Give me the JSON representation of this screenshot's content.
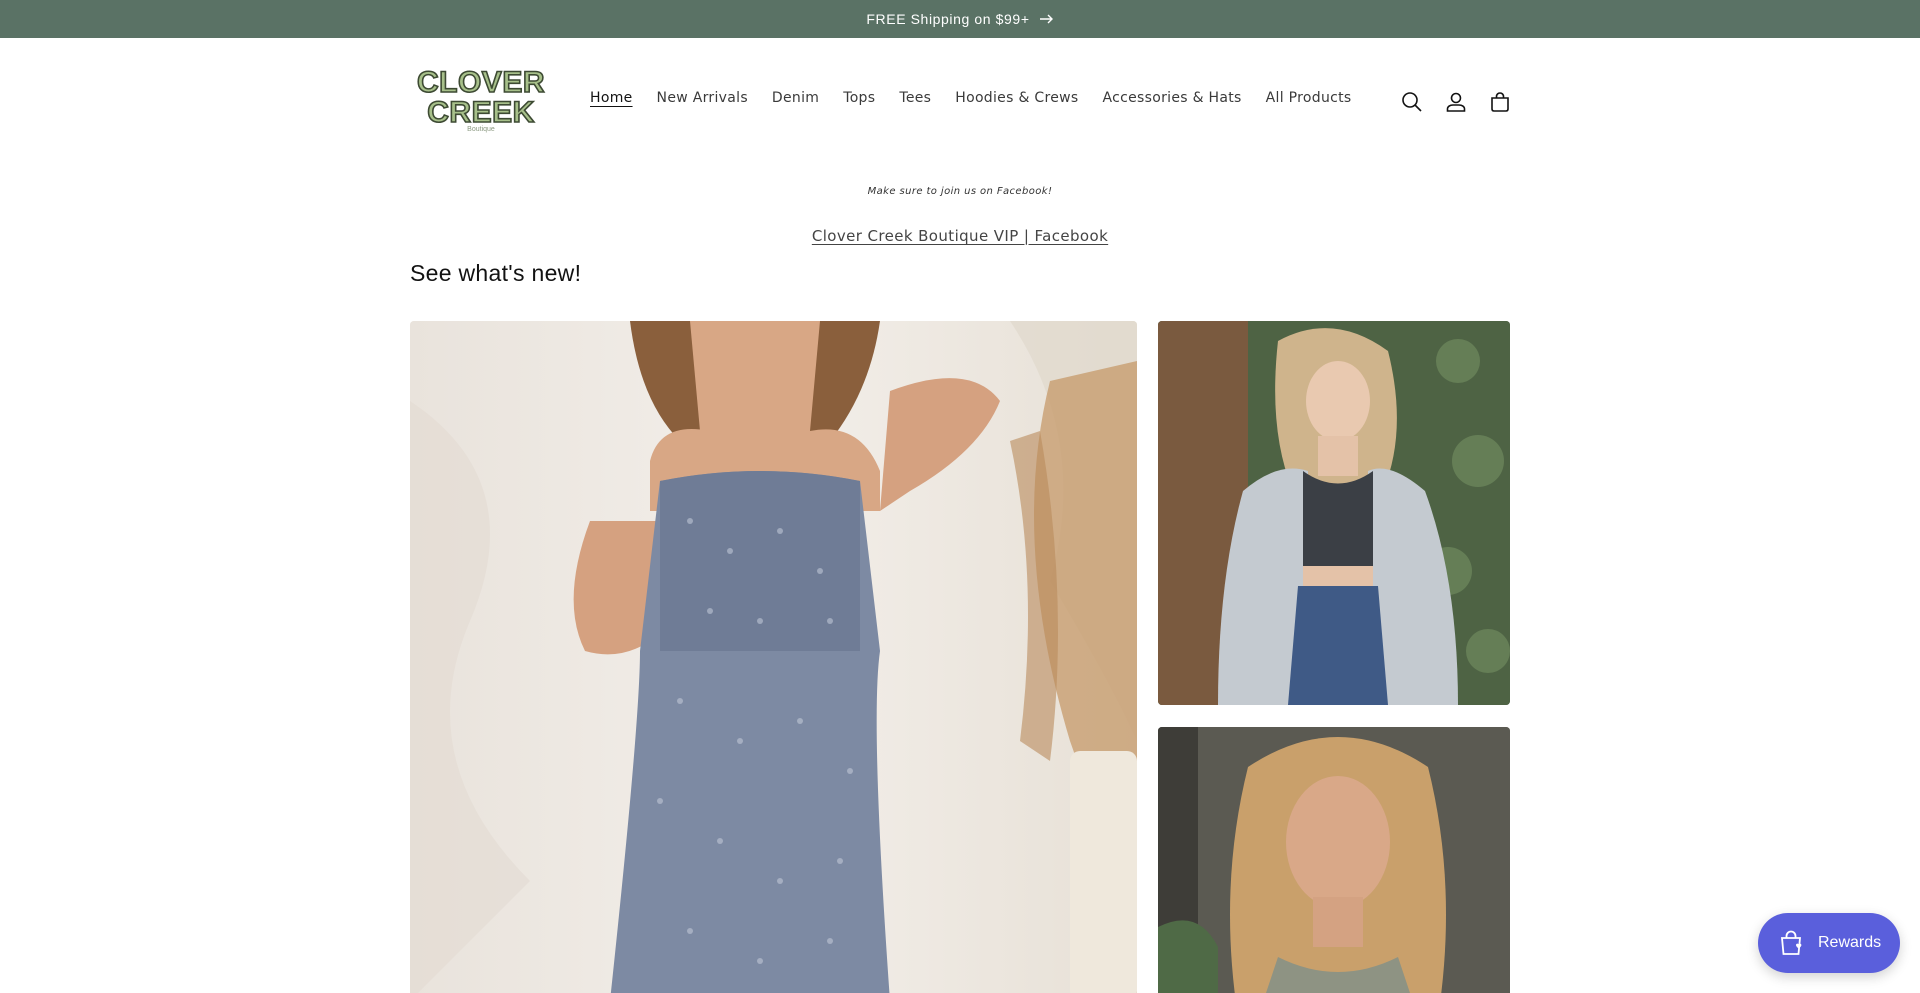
{
  "announcement": {
    "text": "FREE Shipping on $99+"
  },
  "logo": {
    "line1": "CLOVER",
    "line2": "CREEK",
    "line3": "Boutique"
  },
  "nav": {
    "items": [
      {
        "label": "Home",
        "active": true
      },
      {
        "label": "New Arrivals"
      },
      {
        "label": "Denim"
      },
      {
        "label": "Tops"
      },
      {
        "label": "Tees"
      },
      {
        "label": "Hoodies & Crews"
      },
      {
        "label": "Accessories & Hats"
      },
      {
        "label": "All Products"
      }
    ]
  },
  "header_icons": [
    "search-icon",
    "account-icon",
    "cart-icon"
  ],
  "content": {
    "facebook_note": "Make sure to join us on Facebook!",
    "facebook_link": "Clover Creek Boutique VIP | Facebook",
    "section_title": "See what's new!"
  },
  "rewards": {
    "label": "Rewards"
  },
  "colors": {
    "announcement_bg": "#5a7265",
    "rewards_bg": "#5a5fdc",
    "logo_green": "#a7c08a"
  }
}
